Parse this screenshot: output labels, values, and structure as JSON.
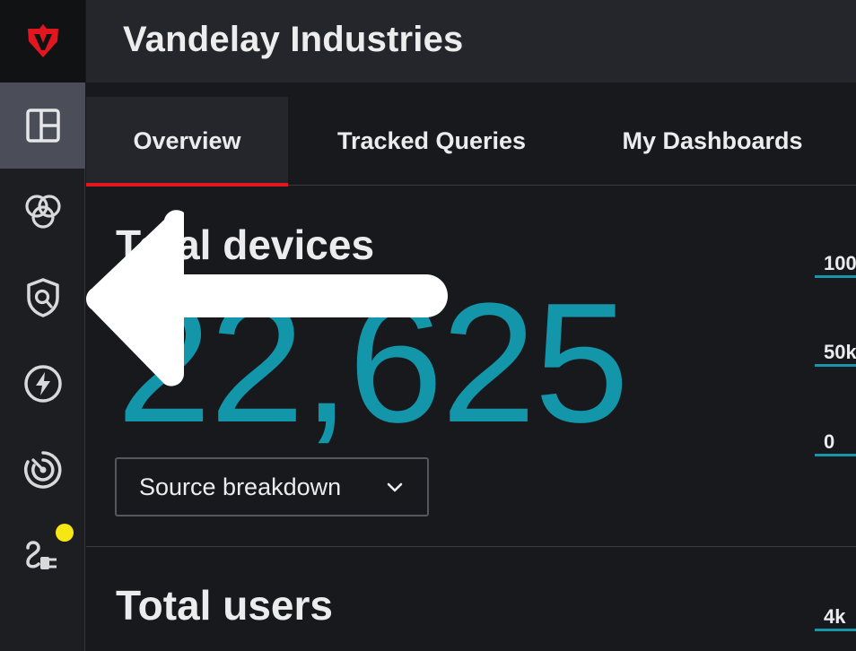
{
  "header": {
    "org_name": "Vandelay Industries"
  },
  "sidebar": {
    "items": [
      {
        "name": "dashboards",
        "icon": "layout-icon",
        "active": true
      },
      {
        "name": "intersections",
        "icon": "circles-overlap-icon",
        "active": false
      },
      {
        "name": "security",
        "icon": "shield-search-icon",
        "active": false
      },
      {
        "name": "actions",
        "icon": "lightning-icon",
        "active": false
      },
      {
        "name": "radar",
        "icon": "radar-icon",
        "active": false
      },
      {
        "name": "integrations",
        "icon": "plug-icon",
        "active": false,
        "has_badge": true
      }
    ]
  },
  "tabs": [
    {
      "label": "Overview",
      "active": true
    },
    {
      "label": "Tracked Queries",
      "active": false
    },
    {
      "label": "My Dashboards",
      "active": false
    }
  ],
  "devices_card": {
    "title": "Total devices",
    "value": "22,625",
    "dropdown_label": "Source breakdown"
  },
  "users_card": {
    "title": "Total users"
  },
  "mini_chart": {
    "ticks": [
      "100",
      "50k",
      "0"
    ],
    "users_tick": "4k"
  },
  "colors": {
    "accent": "#1396a9",
    "active_tab_underline": "#e2161f",
    "badge": "#f5e614",
    "brand": "#e2161f"
  }
}
